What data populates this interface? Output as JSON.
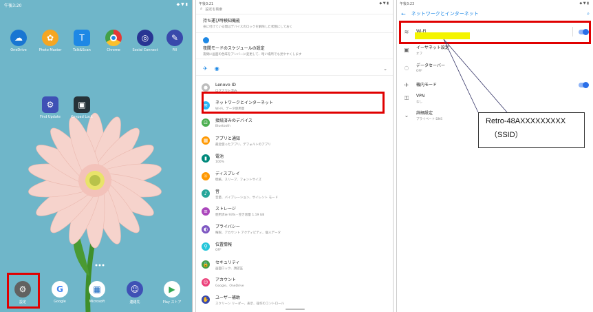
{
  "home": {
    "statusbar": {
      "time": "午後3:20"
    },
    "apps_row1": [
      {
        "label": "OneDrive",
        "color": "#1976d2",
        "glyph": "☁"
      },
      {
        "label": "Photo Master",
        "color": "#f5a623",
        "glyph": "✿"
      },
      {
        "label": "Talk&Scan",
        "color": "#1e88e5",
        "glyph": "T"
      },
      {
        "label": "Chrome",
        "color": "#e53935",
        "glyph": "◉"
      },
      {
        "label": "Social Connect",
        "color": "#283593",
        "glyph": "◎"
      },
      {
        "label": "Fill",
        "color": "#3949ab",
        "glyph": "✎"
      }
    ],
    "apps_row2": [
      {
        "label": "Find Update",
        "color": "#3f51b5",
        "glyph": "⚙"
      },
      {
        "label": "Keypad Lock",
        "color": "#263238",
        "glyph": "▣"
      }
    ],
    "dock": [
      {
        "label": "設定",
        "color": "#616161",
        "glyph": "⚙"
      },
      {
        "label": "Google",
        "color": "#ffffff",
        "glyph": "G"
      },
      {
        "label": "Microsoft",
        "color": "#1565c0",
        "glyph": "▦"
      },
      {
        "label": "連絡先",
        "color": "#3f51b5",
        "glyph": "☺"
      },
      {
        "label": "Play ストア",
        "color": "#ffffff",
        "glyph": "▶"
      }
    ]
  },
  "settings": {
    "statusbar": {
      "time": "午後3:21"
    },
    "search_placeholder": "設定を検索",
    "top_cards": [
      {
        "title": "持ち運び時検知機能",
        "sub": "身に付けている間はデバイスのロックを解除した状態にしておく"
      },
      {
        "title": "夜間モードのスケジュールの設定",
        "sub": "夜間に画面の色味をアンバーに変更して、暗い場所でも見やすくします"
      }
    ],
    "items": [
      {
        "title": "Lenovo ID",
        "sub": "ログアウト済み",
        "color": "#bdbdbd",
        "glyph": "●"
      },
      {
        "title": "ネットワークとインターネット",
        "sub": "Wi-Fi、データ使用量",
        "color": "#29b6f6",
        "glyph": "≋"
      },
      {
        "title": "接続済みのデバイス",
        "sub": "Bluetooth",
        "color": "#4caf50",
        "glyph": "⊡"
      },
      {
        "title": "アプリと通知",
        "sub": "最近使ったアプリ、デフォルトのアプリ",
        "color": "#ff9800",
        "glyph": "▦"
      },
      {
        "title": "電池",
        "sub": "100%",
        "color": "#00897b",
        "glyph": "▮"
      },
      {
        "title": "ディスプレイ",
        "sub": "壁紙、スリープ、フォントサイズ",
        "color": "#ff9800",
        "glyph": "☼"
      },
      {
        "title": "音",
        "sub": "音量、バイブレーション、サイレント モード",
        "color": "#26a69a",
        "glyph": "♪"
      },
      {
        "title": "ストレージ",
        "sub": "使用済み 93%・空き容量 1.19 GB",
        "color": "#ab47bc",
        "glyph": "≡"
      },
      {
        "title": "プライバシー",
        "sub": "権限、アカウント アクティビティ、個人データ",
        "color": "#7e57c2",
        "glyph": "◐"
      },
      {
        "title": "位置情報",
        "sub": "OFF",
        "color": "#26c6da",
        "glyph": "⚲"
      },
      {
        "title": "セキュリティ",
        "sub": "画面ロック、顔認証",
        "color": "#43a047",
        "glyph": "🔒"
      },
      {
        "title": "アカウント",
        "sub": "Google、OneDrive",
        "color": "#ec407a",
        "glyph": "☺"
      },
      {
        "title": "ユーザー補助",
        "sub": "スクリーン リーダー、表示、操作のコントロール",
        "color": "#3949ab",
        "glyph": "✋"
      }
    ]
  },
  "network": {
    "statusbar": {
      "time": "午後3:23"
    },
    "title": "ネットワークとインターネット",
    "items": [
      {
        "title": "Wi-Fi",
        "sub": "",
        "glyph": "≋",
        "toggle": true
      },
      {
        "title": "イーサネット設定",
        "sub": "オフ",
        "glyph": "▣",
        "toggle": false
      },
      {
        "title": "データセーバー",
        "sub": "OFF",
        "glyph": "◌",
        "toggle": false
      },
      {
        "title": "機内モード",
        "sub": "",
        "glyph": "✈",
        "toggle": true
      },
      {
        "title": "VPN",
        "sub": "なし",
        "glyph": "⚿",
        "toggle": false
      },
      {
        "title": "詳細設定",
        "sub": "プライベート DNS",
        "glyph": "⌄",
        "toggle": false
      }
    ],
    "callout": {
      "line1": "Retro-48AXXXXXXXXX",
      "line2": "（SSID）"
    },
    "highlight_color": "#f4f400"
  }
}
